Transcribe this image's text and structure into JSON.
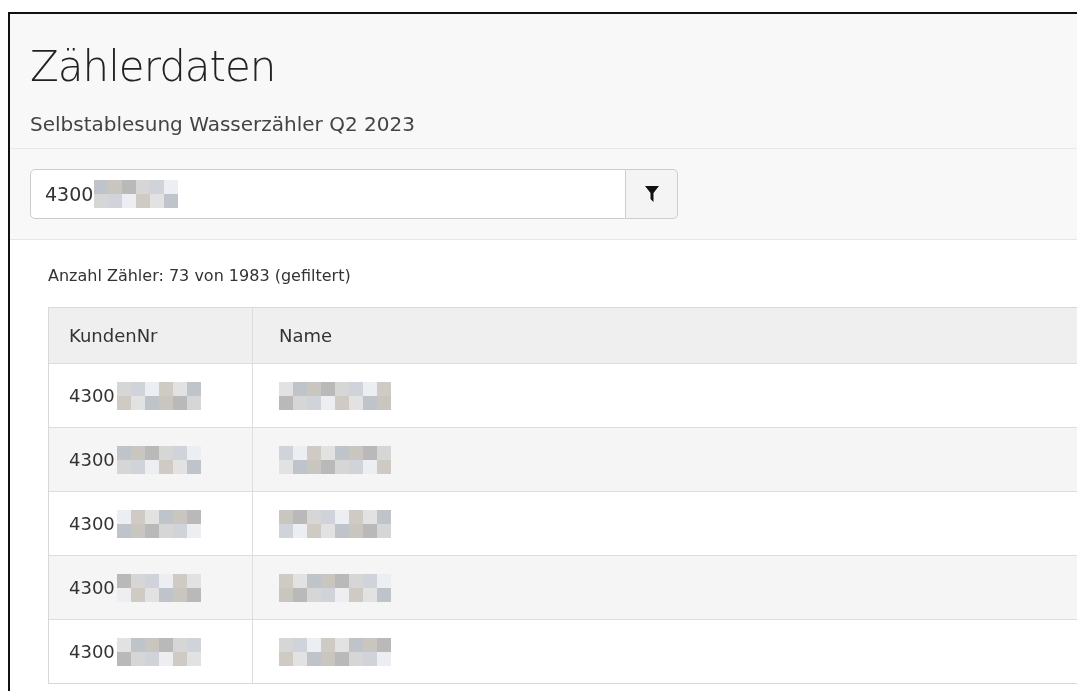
{
  "page": {
    "title": "Zählerdaten",
    "subtitle": "Selbstablesung Wasserzähler Q2 2023"
  },
  "filter": {
    "value": "4300"
  },
  "count": "Anzahl Zähler: 73 von 1983 (gefiltert)",
  "table": {
    "columns": [
      "KundenNr",
      "Name"
    ],
    "rows": [
      {
        "kundennr": "4300"
      },
      {
        "kundennr": "4300"
      },
      {
        "kundennr": "4300"
      },
      {
        "kundennr": "4300"
      },
      {
        "kundennr": "4300"
      }
    ]
  }
}
